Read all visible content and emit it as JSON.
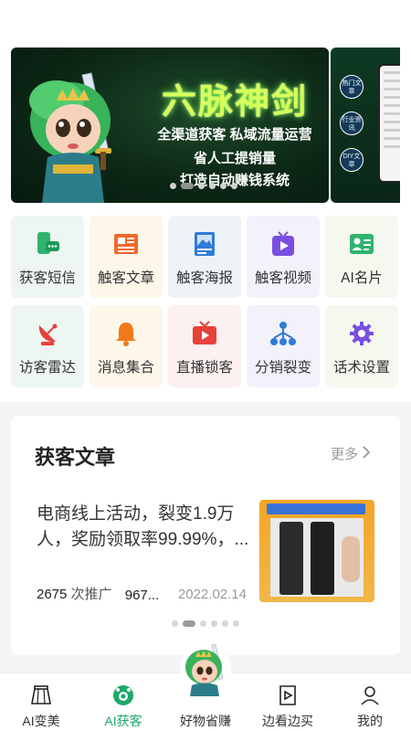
{
  "banner": {
    "title": "六脉神剑",
    "line1": "全渠道获客 私域流量运营",
    "line2": "省人工提销量",
    "line3": "打造自动赚钱系统",
    "side_tags": [
      "热门文章",
      "行业资讯",
      "DIY文章"
    ],
    "dot_count": 6,
    "active_dot": 1
  },
  "grid": [
    {
      "label": "获客短信",
      "icon": "sms-phone-icon",
      "color": "#2fb36e"
    },
    {
      "label": "触客文章",
      "icon": "article-icon",
      "color": "#f06a2e"
    },
    {
      "label": "触客海报",
      "icon": "poster-icon",
      "color": "#2f7bd8"
    },
    {
      "label": "触客视频",
      "icon": "video-icon",
      "color": "#7a4fe0"
    },
    {
      "label": "AI名片",
      "icon": "business-card-icon",
      "color": "#2fb36e"
    },
    {
      "label": "访客雷达",
      "icon": "radar-icon",
      "color": "#e8413a"
    },
    {
      "label": "消息集合",
      "icon": "bell-icon",
      "color": "#f07a1a"
    },
    {
      "label": "直播锁客",
      "icon": "tv-icon",
      "color": "#e8413a"
    },
    {
      "label": "分销裂变",
      "icon": "network-icon",
      "color": "#2f7bd8"
    },
    {
      "label": "话术设置",
      "icon": "gear-icon",
      "color": "#7a4fe0"
    }
  ],
  "article_card": {
    "title": "获客文章",
    "more_label": "更多",
    "article": {
      "text": "电商线上活动，裂变1.9万人，奖励领取率99.99%，...",
      "promote_count": "2675",
      "promote_label": "次推广",
      "views": "967...",
      "date": "2022.02.14"
    },
    "dot_count": 6,
    "active_dot": 1
  },
  "nav": [
    {
      "label": "AI变美",
      "icon": "skirt-icon",
      "active": false
    },
    {
      "label": "AI获客",
      "icon": "ai-customer-icon",
      "active": true
    },
    {
      "label": "好物省赚",
      "icon": "mascot-icon",
      "active": false
    },
    {
      "label": "边看边买",
      "icon": "play-icon",
      "active": false
    },
    {
      "label": "我的",
      "icon": "user-icon",
      "active": false
    }
  ],
  "colors": {
    "accent": "#1ea86a",
    "banner_title": "#d8ff5a"
  }
}
